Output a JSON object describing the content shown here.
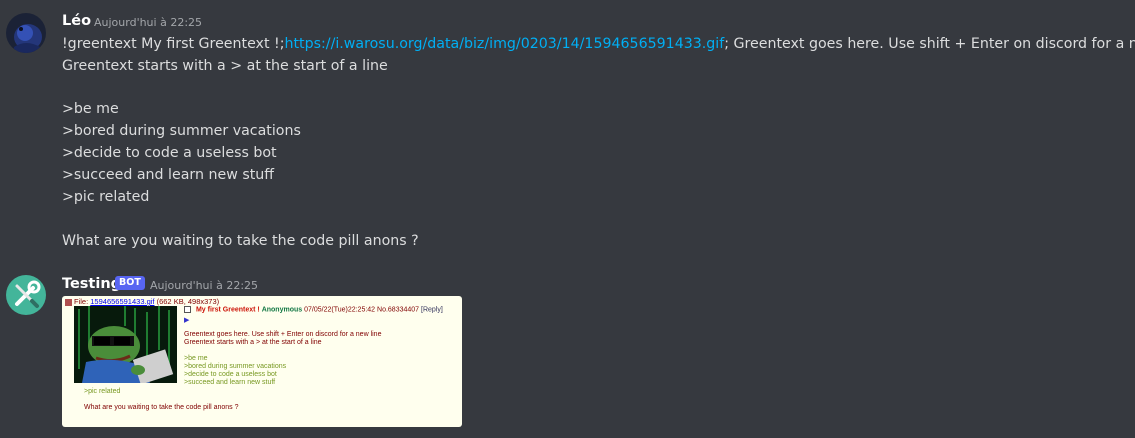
{
  "messages": [
    {
      "author": "Léo",
      "timestamp": "Aujourd'hui à 22:25",
      "line1_prefix": "!greentext My first Greentext !;",
      "line1_link": "https://i.warosu.org/data/biz/img/0203/14/1594656591433.gif",
      "line1_suffix": "; Greentext goes here. Use shift + Enter on discord for a new line",
      "lines": [
        "Greentext starts with a > at the start of a line",
        ">be me",
        ">bored during summer vacations",
        ">decide to code a useless bot",
        ">succeed and learn new stuff",
        ">pic related",
        "What are you waiting to take the code pill anons ?"
      ]
    },
    {
      "author": "Testing",
      "badge": "BOT",
      "timestamp": "Aujourd'hui à 22:25"
    }
  ],
  "embed": {
    "file_label": "File:",
    "file_name": "1594656591433.gif",
    "file_meta": "(662 KB, 498x373)",
    "subject": "My first Greentext !",
    "name": "Anonymous",
    "date_no": "07/05/22(Tue)22:25:42 No.68334407",
    "reply": "[Reply]",
    "arrow": "▶",
    "body": [
      "Greentext goes here. Use shift + Enter on discord for a new line",
      "Greentext starts with a > at the start of a line"
    ],
    "greentext": [
      ">be me",
      ">bored during summer vacations",
      ">decide to code a useless bot",
      ">succeed and learn new stuff"
    ],
    "pic_related": ">pic related",
    "closing": "What are you waiting to take the code pill anons ?"
  },
  "colors": {
    "background": "#36393f",
    "link": "#00aff4",
    "bot_badge": "#5865f2",
    "card_bg": "#ffffee",
    "greentext": "#789922",
    "subject": "#cc1105",
    "anonymous": "#117743"
  },
  "icons": {
    "leo_avatar": "blue-creature-avatar-icon",
    "bot_avatar": "wrench-screwdriver-avatar-icon"
  }
}
